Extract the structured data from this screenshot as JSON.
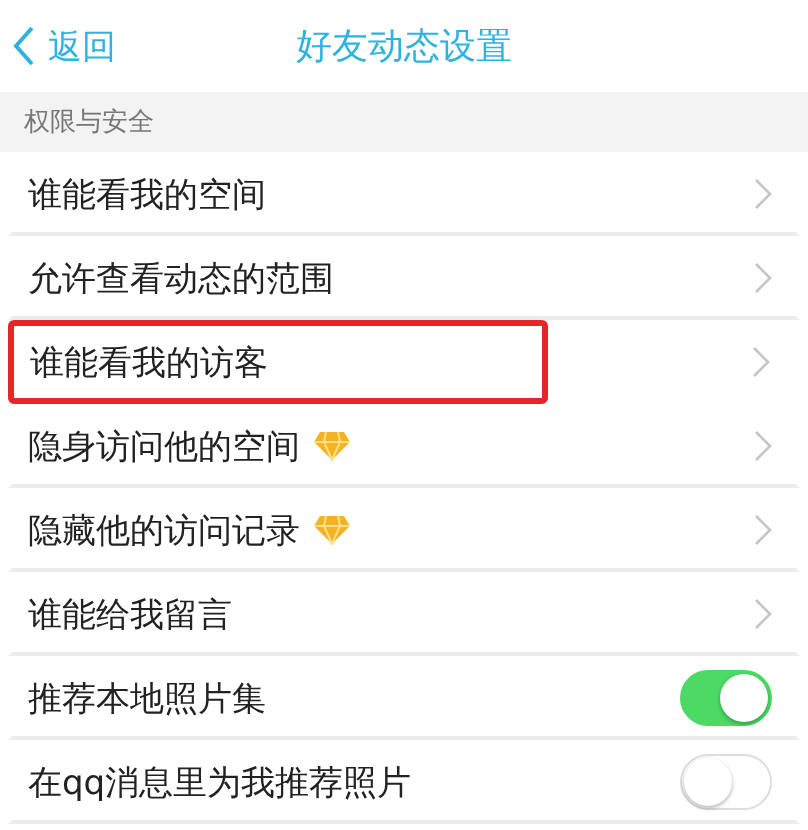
{
  "header": {
    "back": "返回",
    "title": "好友动态设置"
  },
  "section": "权限与安全",
  "rows": [
    {
      "label": "谁能看我的空间",
      "kind": "arrow",
      "vip": false,
      "highlighted": false
    },
    {
      "label": "允许查看动态的范围",
      "kind": "arrow",
      "vip": false,
      "highlighted": false
    },
    {
      "label": "谁能看我的访客",
      "kind": "arrow",
      "vip": false,
      "highlighted": true
    },
    {
      "label": "隐身访问他的空间",
      "kind": "arrow",
      "vip": true,
      "highlighted": false
    },
    {
      "label": "隐藏他的访问记录",
      "kind": "arrow",
      "vip": true,
      "highlighted": false
    },
    {
      "label": "谁能给我留言",
      "kind": "arrow",
      "vip": false,
      "highlighted": false
    },
    {
      "label": "推荐本地照片集",
      "kind": "toggle",
      "on": true,
      "vip": false,
      "highlighted": false
    },
    {
      "label": "在qq消息里为我推荐照片",
      "kind": "toggle",
      "on": false,
      "vip": false,
      "highlighted": false
    }
  ]
}
